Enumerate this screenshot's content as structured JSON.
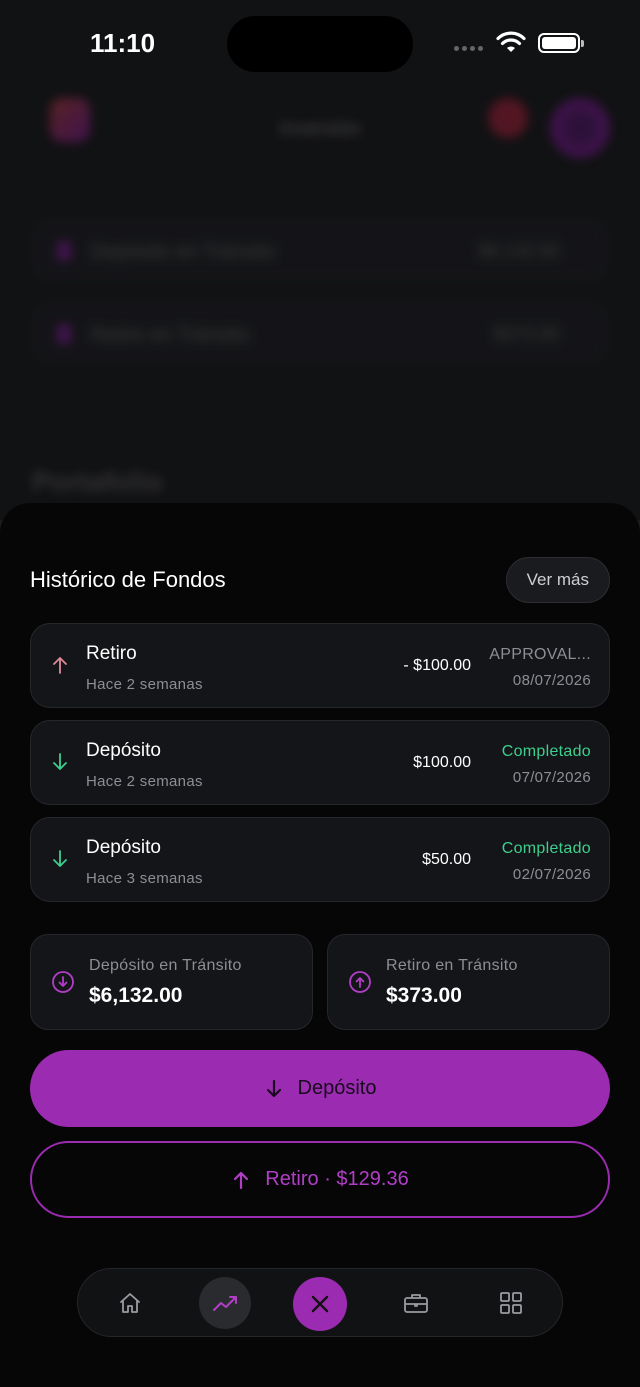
{
  "status_bar": {
    "time": "11:10"
  },
  "background": {
    "header_title": "Inversión",
    "cards": [
      {
        "label": "Depósito en Tránsito",
        "value": "$6,132.00"
      },
      {
        "label": "Retiro en Tránsito",
        "value": "$373.00"
      }
    ],
    "section_title": "Portafolio"
  },
  "sheet": {
    "title": "Histórico de Fondos",
    "see_more": "Ver más",
    "transactions": [
      {
        "label": "Retiro",
        "time_ago": "Hace 2 semanas",
        "amount": "- $100.00",
        "status": "APPROVAL...",
        "date": "08/07/2026",
        "direction": "up",
        "status_color": "#8d8e94"
      },
      {
        "label": "Depósito",
        "time_ago": "Hace 2 semanas",
        "amount": "$100.00",
        "status": "Completado",
        "date": "07/07/2026",
        "direction": "down",
        "status_color": "#3ecf8e"
      },
      {
        "label": "Depósito",
        "time_ago": "Hace 3 semanas",
        "amount": "$50.00",
        "status": "Completado",
        "date": "02/07/2026",
        "direction": "down",
        "status_color": "#3ecf8e"
      }
    ],
    "transit": {
      "deposit": {
        "label": "Depósito en Tránsito",
        "value": "$6,132.00"
      },
      "withdrawal": {
        "label": "Retiro en Tránsito",
        "value": "$373.00"
      }
    },
    "deposit_button": "Depósito",
    "withdraw_button": "Retiro · $129.36"
  },
  "colors": {
    "accent": "#9b2bb0",
    "success": "#3ecf8e",
    "up_arrow": "#e0899a",
    "down_arrow": "#3ecf8e"
  },
  "nav": {
    "items": [
      "home-icon",
      "trend-chart-icon",
      "close-icon",
      "briefcase-icon",
      "grid-icon"
    ],
    "active": "trend-chart-icon"
  }
}
